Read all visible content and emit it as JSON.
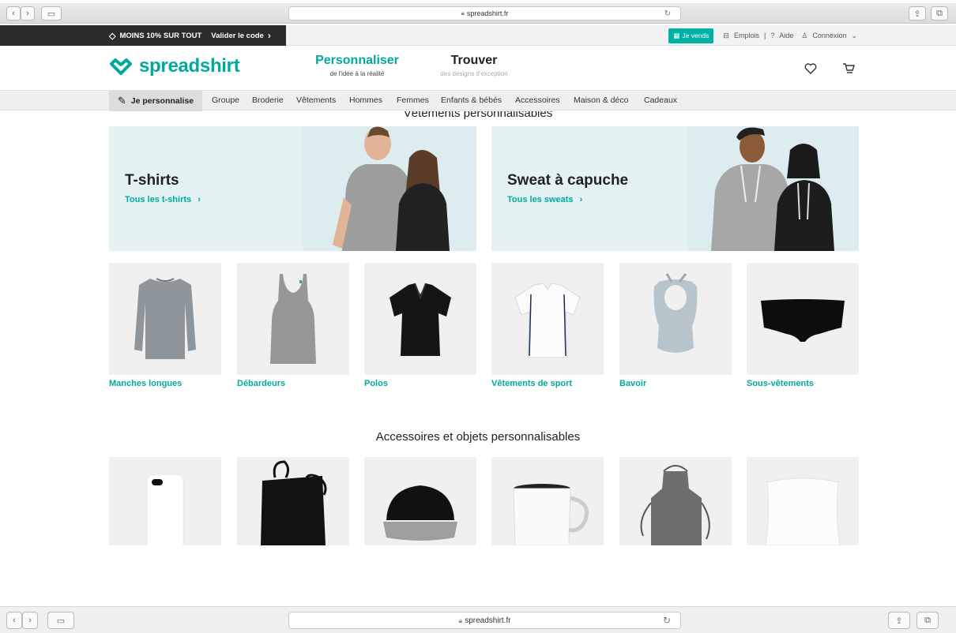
{
  "browser": {
    "url": "spreadshirt.fr"
  },
  "promo": {
    "discount_text": "MOINS 10% SUR TOUT",
    "code_link": "Valider le code",
    "sell_button": "Je vends",
    "jobs": "Emplois",
    "help": "Aide",
    "login": "Connexion"
  },
  "header": {
    "logo": "spreadshirt",
    "tabs": [
      {
        "title": "Personnaliser",
        "subtitle": "de l'idée à la réalité"
      },
      {
        "title": "Trouver",
        "subtitle": "des designs d'exception"
      }
    ]
  },
  "catnav": {
    "active": "Je personnalise",
    "items": [
      "Groupe",
      "Broderie",
      "Vêtements",
      "Hommes",
      "Femmes",
      "Enfants & bébés",
      "Accessoires",
      "Maison & déco",
      "Cadeaux"
    ]
  },
  "sections": {
    "clothing_title": "Vêtements personnalisables",
    "accessories_title": "Accessoires et objets personnalisables"
  },
  "banners": [
    {
      "title": "T-shirts",
      "link": "Tous les t-shirts"
    },
    {
      "title": "Sweat à capuche",
      "link": "Tous les sweats"
    }
  ],
  "products": [
    "Manches longues",
    "Débardeurs",
    "Polos",
    "Vêtements de sport",
    "Bavoir",
    "Sous-vêtements"
  ],
  "colors": {
    "brand": "#00a99d",
    "banner_bg": "#e4f2f4",
    "sell_button": "#00b2a5"
  }
}
